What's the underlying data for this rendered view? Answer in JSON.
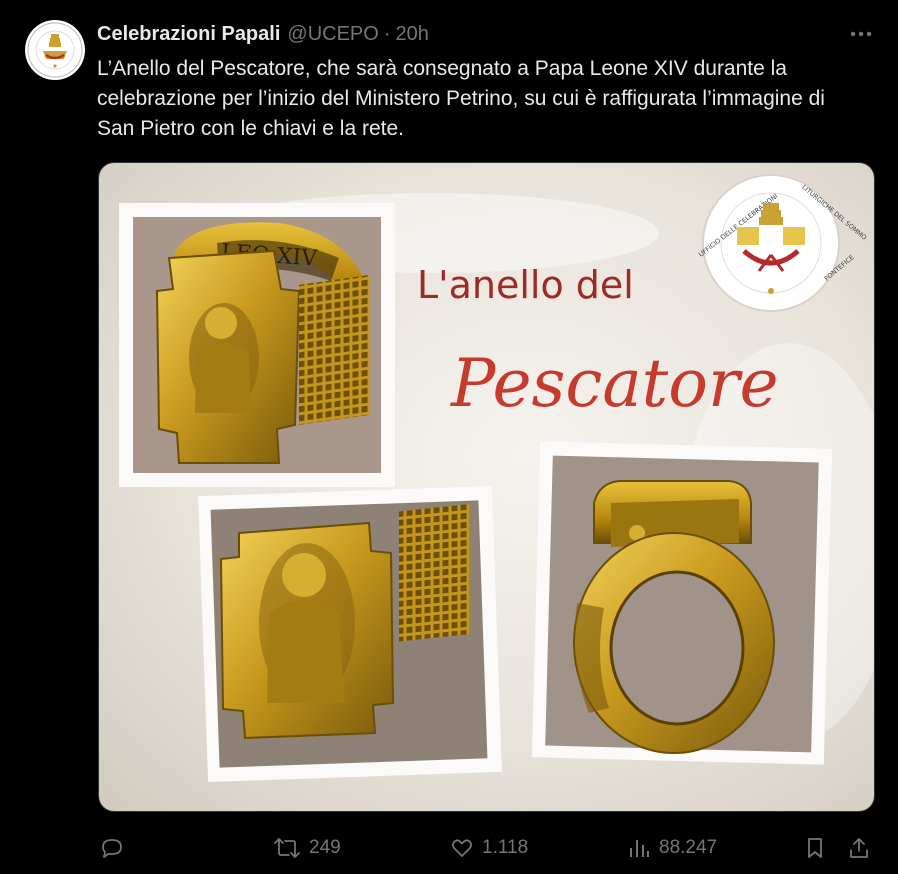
{
  "tweet": {
    "author_name": "Celebrazioni Papali",
    "handle": "@UCEPO",
    "separator": "·",
    "time": "20h",
    "text": "L’Anello del Pescatore, che sarà consegnato a Papa Leone XIV durante la celebrazione per l’inizio del Ministero Petrino, su cui è raffigurata l’immagine di San Pietro con le chiavi e la rete."
  },
  "media": {
    "title_line1": "L'anello del",
    "title_line2": "Pescatore",
    "ring1_engraving": "LEO XIV",
    "seal_text": "UFFICIO DELLE CELEBRAZIONI LITURGICHE DEL SOMMO PONTEFICE"
  },
  "actions": {
    "reply_count": "",
    "repost_count": "249",
    "like_count": "1.118",
    "views_count": "88.247"
  },
  "icons": {
    "more": "more-icon",
    "reply": "reply-icon",
    "repost": "repost-icon",
    "like": "heart-icon",
    "views": "views-icon",
    "bookmark": "bookmark-icon",
    "share": "share-icon"
  },
  "colors": {
    "background": "#000000",
    "text": "#e7e9ea",
    "muted": "#71767b",
    "title_red": "#9e2a24",
    "gold": "#c9a233"
  }
}
